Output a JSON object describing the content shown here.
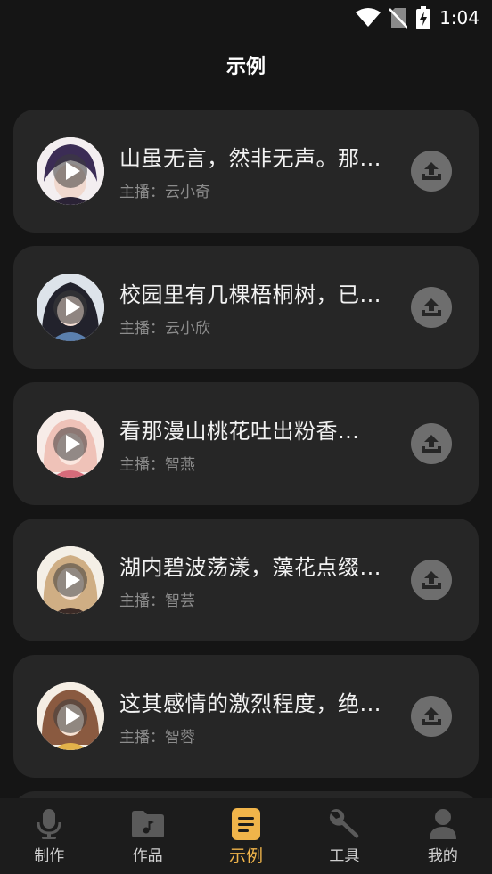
{
  "status_bar": {
    "time": "1:04"
  },
  "header": {
    "title": "示例"
  },
  "items": [
    {
      "title": "山虽无言，然非无声。那...",
      "anchor": "主播：云小奇",
      "avatar_tone": "#5b4a78"
    },
    {
      "title": "校园里有几棵梧桐树，已...",
      "anchor": "主播：云小欣",
      "avatar_tone": "#2c2c3a"
    },
    {
      "title": "看那漫山桃花吐出粉香...",
      "anchor": "主播：智燕",
      "avatar_tone": "#e9b7b0"
    },
    {
      "title": "湖内碧波荡漾，藻花点缀...",
      "anchor": "主播：智芸",
      "avatar_tone": "#c9a87a"
    },
    {
      "title": "这其感情的激烈程度，绝...",
      "anchor": "主播：智蓉",
      "avatar_tone": "#8a5a40"
    }
  ],
  "nav": [
    {
      "label": "制作",
      "icon": "microphone-icon"
    },
    {
      "label": "作品",
      "icon": "music-folder-icon"
    },
    {
      "label": "示例",
      "icon": "document-icon"
    },
    {
      "label": "工具",
      "icon": "wrench-icon"
    },
    {
      "label": "我的",
      "icon": "person-icon"
    }
  ],
  "colors": {
    "accent": "#f0b44a",
    "card": "#262626",
    "background": "#151515"
  }
}
